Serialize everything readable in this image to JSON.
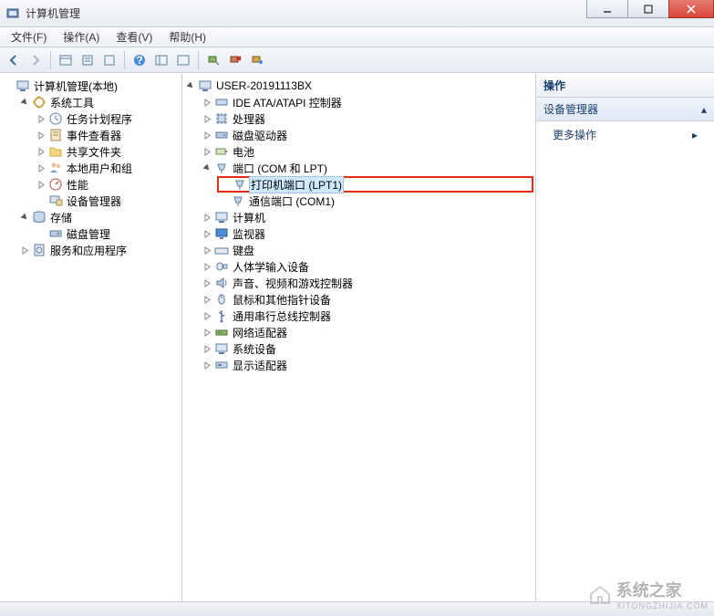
{
  "window": {
    "title": "计算机管理",
    "buttons": {
      "min": "min",
      "max": "max",
      "close": "close"
    }
  },
  "menu": {
    "file": "文件(F)",
    "action": "操作(A)",
    "view": "查看(V)",
    "help": "帮助(H)"
  },
  "left_tree": {
    "root": "计算机管理(本地)",
    "system_tools": "系统工具",
    "task_scheduler": "任务计划程序",
    "event_viewer": "事件查看器",
    "shared_folders": "共享文件夹",
    "local_users": "本地用户和组",
    "performance": "性能",
    "device_manager": "设备管理器",
    "storage": "存储",
    "disk_management": "磁盘管理",
    "services_apps": "服务和应用程序"
  },
  "device_tree": {
    "computer": "USER-20191113BX",
    "ide": "IDE ATA/ATAPI 控制器",
    "cpu": "处理器",
    "disk_drives": "磁盘驱动器",
    "battery": "电池",
    "ports": "端口 (COM 和 LPT)",
    "printer_port": "打印机端口 (LPT1)",
    "com_port": "通信端口 (COM1)",
    "computers": "计算机",
    "monitors": "监视器",
    "keyboards": "键盘",
    "hid": "人体学输入设备",
    "sound": "声音、视频和游戏控制器",
    "mice": "鼠标和其他指针设备",
    "usb": "通用串行总线控制器",
    "network": "网络适配器",
    "system_devices": "系统设备",
    "display": "显示适配器"
  },
  "actions": {
    "header": "操作",
    "section": "设备管理器",
    "more": "更多操作"
  },
  "watermark": {
    "text": "系统之家",
    "url": "XITONGZHIJIA.COM"
  }
}
